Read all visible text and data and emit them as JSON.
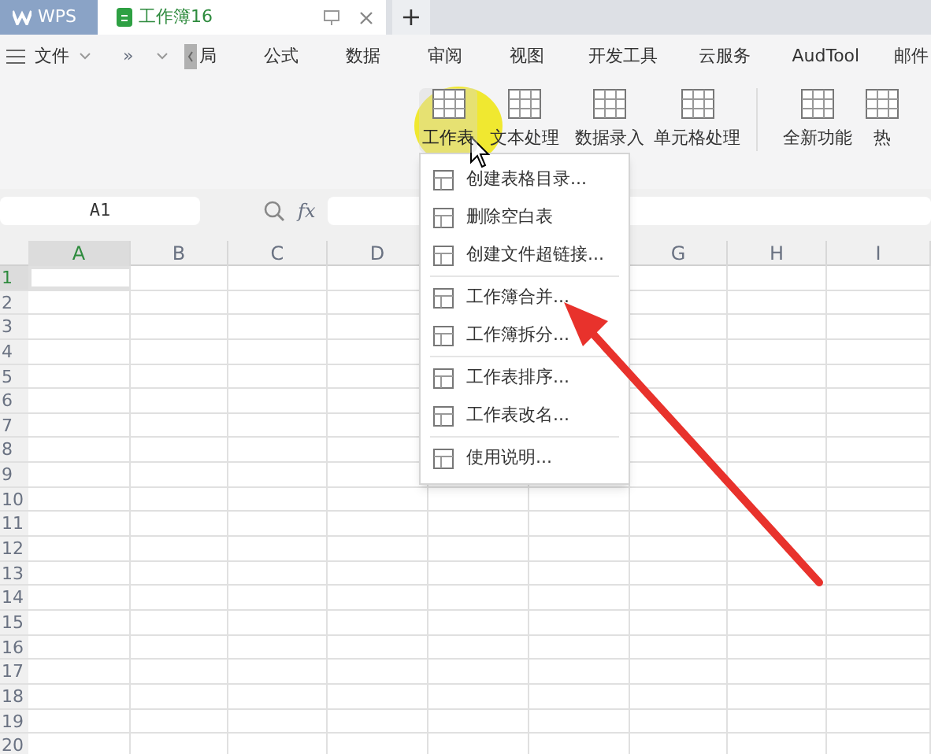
{
  "title_bar": {
    "app_tab": "WPS",
    "tabs": [
      {
        "label": "工作簿16",
        "selected": true
      }
    ],
    "new_tab": "+"
  },
  "menu_bar": {
    "file": "文件",
    "more": "»",
    "items": [
      {
        "label": "局"
      },
      {
        "label": "公式"
      },
      {
        "label": "数据"
      },
      {
        "label": "审阅"
      },
      {
        "label": "视图"
      },
      {
        "label": "开发工具"
      },
      {
        "label": "云服务"
      },
      {
        "label": "AudTool"
      },
      {
        "label": "邮件"
      }
    ]
  },
  "ribbon": [
    {
      "label": "工作表",
      "selected": true,
      "separator_before": false
    },
    {
      "label": "文本处理",
      "selected": false,
      "separator_before": false
    },
    {
      "label": "数据录入",
      "selected": false,
      "separator_before": false
    },
    {
      "label": "单元格处理",
      "selected": false,
      "separator_before": false
    },
    {
      "label": "全新功能",
      "selected": false,
      "separator_before": true
    },
    {
      "label": "热",
      "selected": false,
      "separator_before": false
    }
  ],
  "formula_bar": {
    "name_box": "A1",
    "fx": "fx"
  },
  "columns": [
    {
      "label": "A",
      "selected": true
    },
    {
      "label": "B",
      "selected": false
    },
    {
      "label": "C",
      "selected": false
    },
    {
      "label": "D",
      "selected": false
    },
    {
      "label": "G",
      "selected": false
    },
    {
      "label": "H",
      "selected": false
    },
    {
      "label": "I",
      "selected": false
    }
  ],
  "rows": [
    {
      "label": "1",
      "selected": true
    },
    {
      "label": "2",
      "selected": false
    },
    {
      "label": "3",
      "selected": false
    },
    {
      "label": "4",
      "selected": false
    },
    {
      "label": "5",
      "selected": false
    },
    {
      "label": "6",
      "selected": false
    },
    {
      "label": "7",
      "selected": false
    },
    {
      "label": "8",
      "selected": false
    },
    {
      "label": "9",
      "selected": false
    },
    {
      "label": "10",
      "selected": false
    },
    {
      "label": "11",
      "selected": false
    },
    {
      "label": "12",
      "selected": false
    },
    {
      "label": "13",
      "selected": false
    },
    {
      "label": "14",
      "selected": false
    },
    {
      "label": "15",
      "selected": false
    },
    {
      "label": "16",
      "selected": false
    },
    {
      "label": "17",
      "selected": false
    },
    {
      "label": "18",
      "selected": false
    },
    {
      "label": "19",
      "selected": false
    },
    {
      "label": "20",
      "selected": false
    }
  ],
  "dropdown": [
    {
      "label": "创建表格目录...",
      "separator_after": false
    },
    {
      "label": "删除空白表",
      "separator_after": false
    },
    {
      "label": "创建文件超链接...",
      "separator_after": true
    },
    {
      "label": "工作簿合并...",
      "separator_after": false
    },
    {
      "label": "工作簿拆分...",
      "separator_after": true
    },
    {
      "label": "工作表排序...",
      "separator_after": false
    },
    {
      "label": "工作表改名...",
      "separator_after": true
    },
    {
      "label": "使用说明...",
      "separator_after": false
    }
  ]
}
